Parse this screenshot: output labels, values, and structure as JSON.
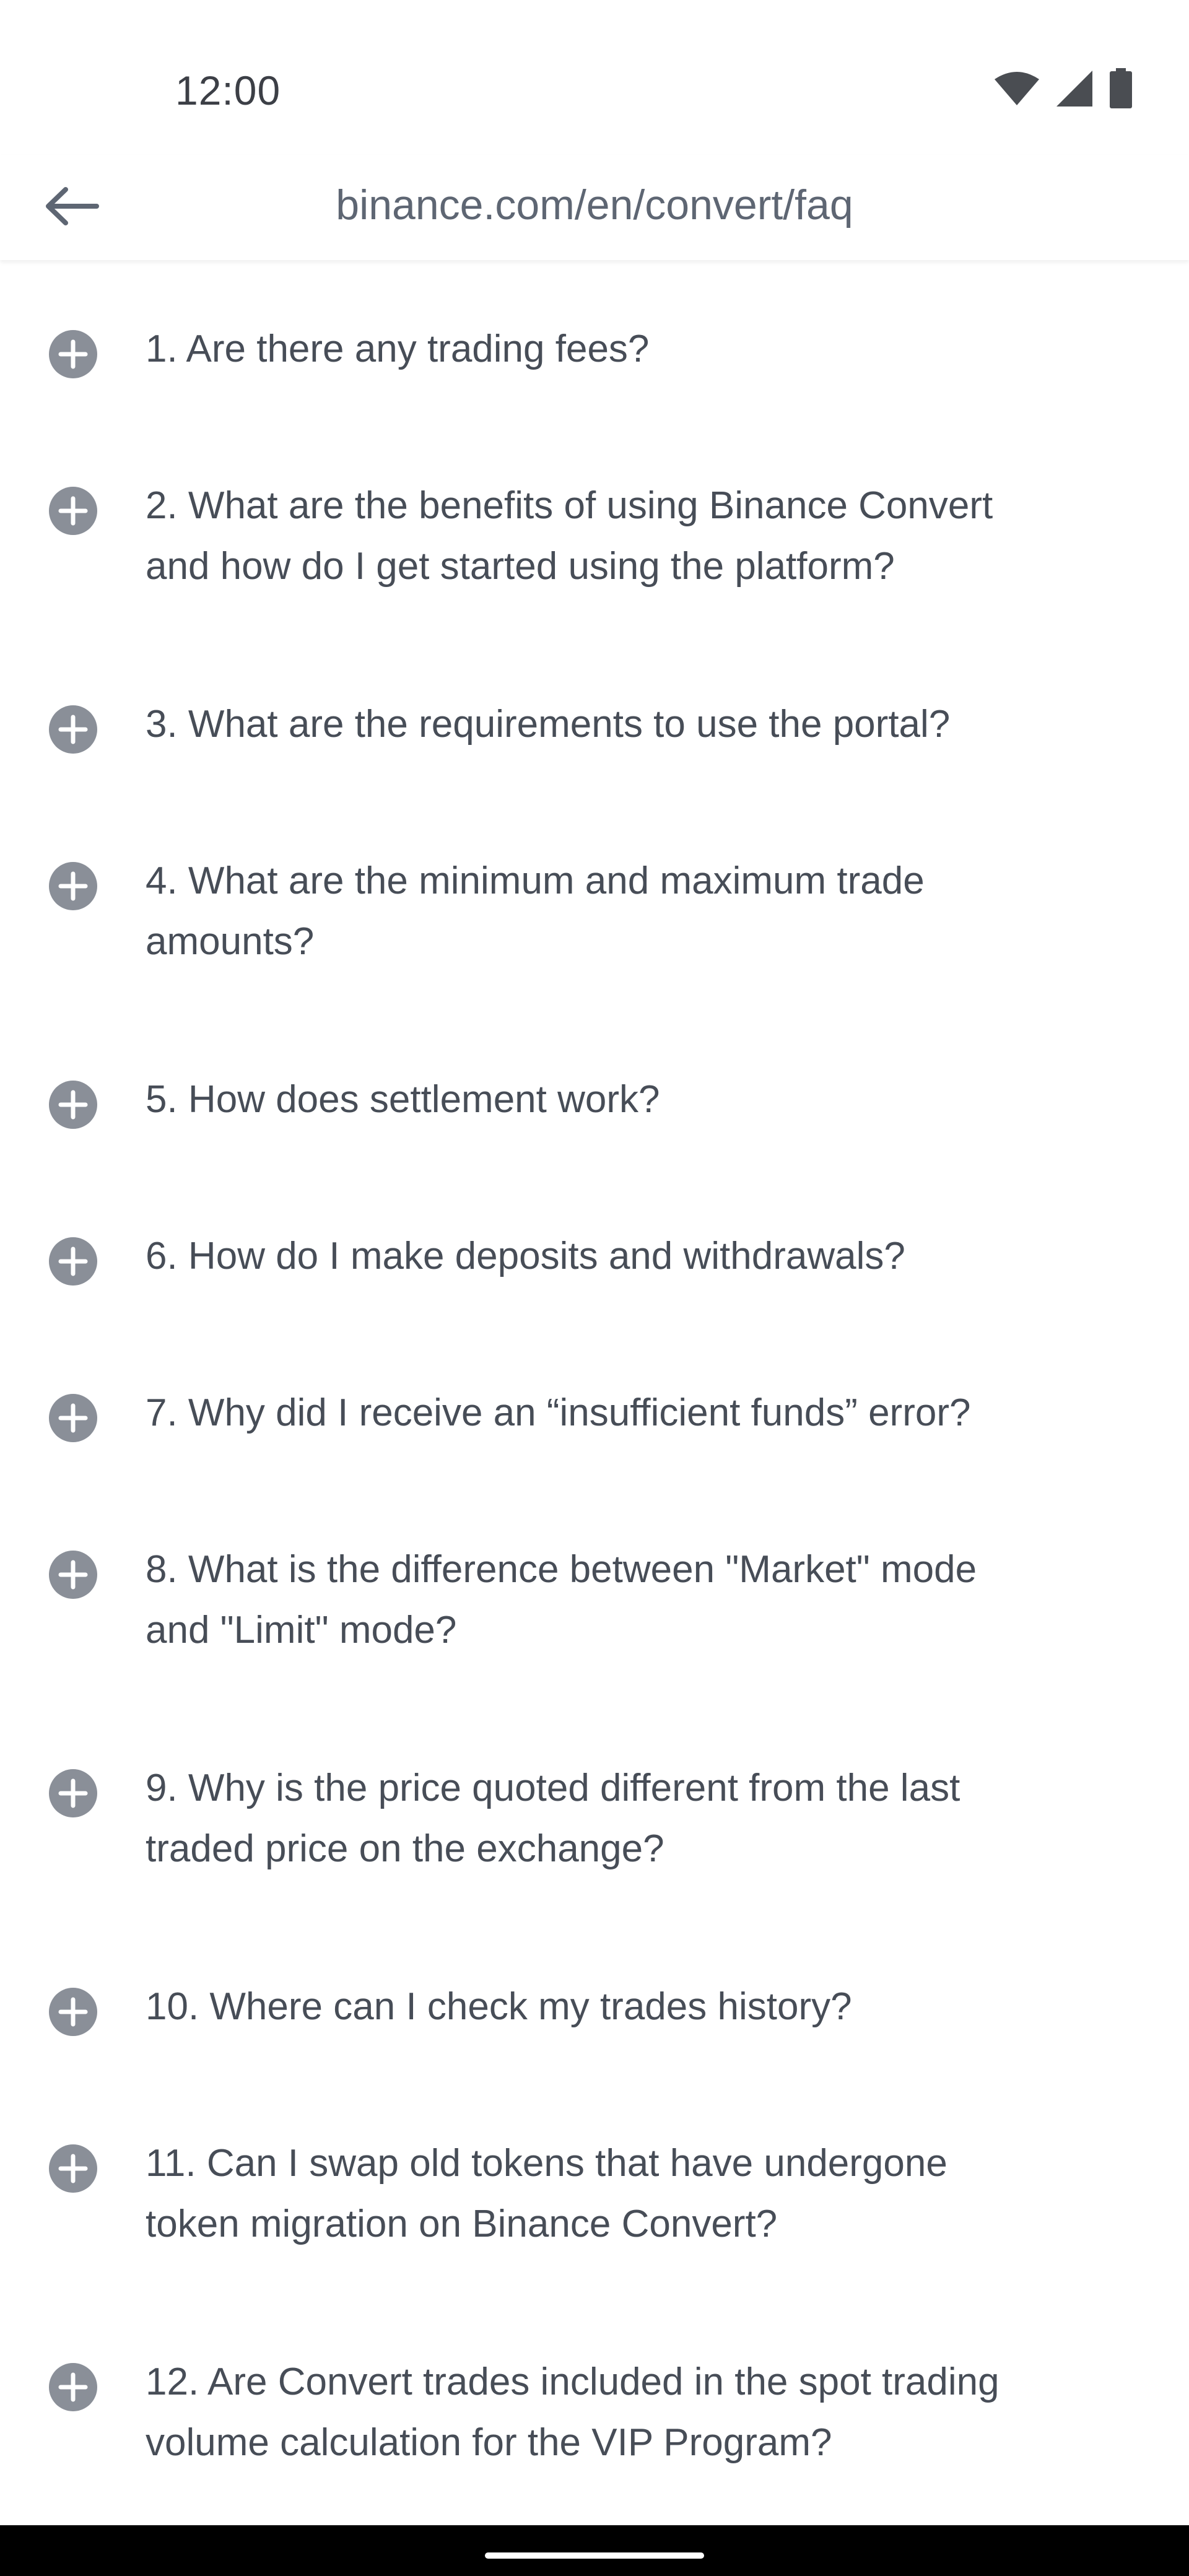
{
  "status_bar": {
    "time": "12:00",
    "icons": [
      "wifi-icon",
      "cellular-signal-icon",
      "battery-icon"
    ]
  },
  "browser": {
    "url": "binance.com/en/convert/faq",
    "back_icon": "arrow-left-icon"
  },
  "faq": {
    "expand_icon": "plus-circle-icon",
    "items": [
      {
        "lines": [
          "1. Are there any trading fees?"
        ]
      },
      {
        "lines": [
          "2. What are the benefits of using Binance Convert",
          "and how do I get started using the platform?"
        ]
      },
      {
        "lines": [
          "3. What are the requirements to use the portal?"
        ]
      },
      {
        "lines": [
          "4. What are the minimum and maximum trade",
          "amounts?"
        ]
      },
      {
        "lines": [
          "5. How does settlement work?"
        ]
      },
      {
        "lines": [
          "6. How do I make deposits and withdrawals?"
        ]
      },
      {
        "lines": [
          "7. Why did I receive an “insufficient funds” error?"
        ]
      },
      {
        "lines": [
          "8. What is the difference between \"Market\" mode",
          "and \"Limit\" mode?"
        ]
      },
      {
        "lines": [
          "9. Why is the price quoted different from the last",
          "traded price on the exchange?"
        ]
      },
      {
        "lines": [
          "10. Where can I check my trades history?"
        ]
      },
      {
        "lines": [
          "11. Can I swap old tokens that have undergone",
          "token migration on Binance Convert?"
        ]
      },
      {
        "lines": [
          "12. Are Convert trades included in the spot trading",
          "volume calculation for the VIP Program?"
        ]
      }
    ]
  },
  "colors": {
    "text": "#474d57",
    "icon": "#8a8f98",
    "background": "#ffffff",
    "nav_bar": "#000000"
  }
}
